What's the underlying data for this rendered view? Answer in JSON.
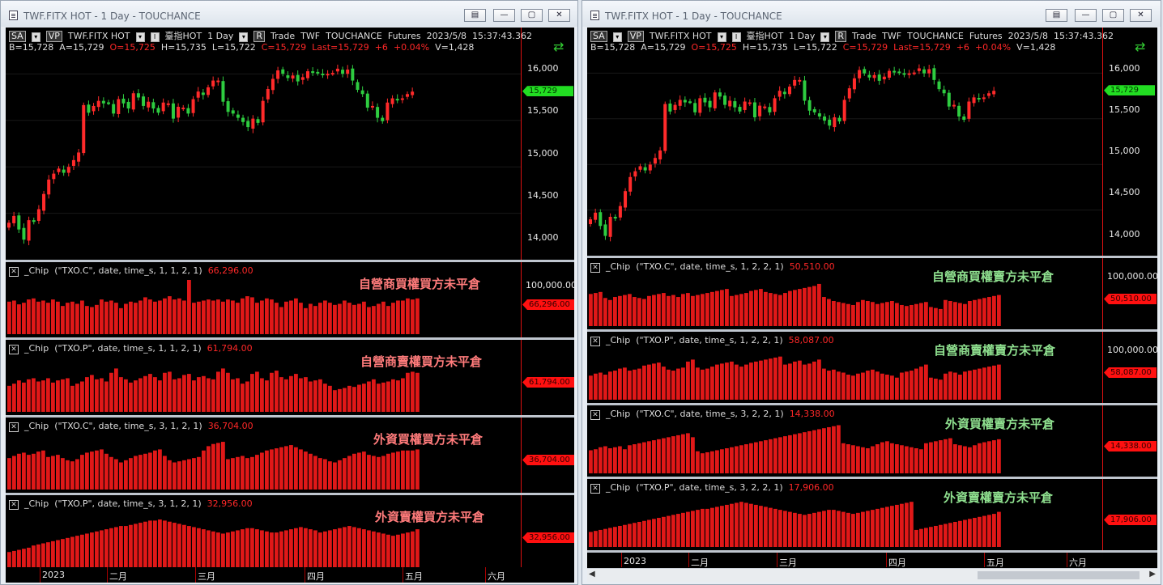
{
  "left": {
    "title": "TWF.FITX HOT - 1 Day - TOUCHANCE",
    "header": {
      "sa": "SA",
      "vp": "VP",
      "symbol": "TWF.FITX HOT",
      "name": "臺指HOT",
      "period": "1 Day",
      "r": "R",
      "trade": "Trade",
      "exch": "TWF",
      "src": "TOUCHANCE",
      "type": "Futures",
      "date": "2023/5/8",
      "time": "15:37:43.362"
    },
    "quote": {
      "b": "B=15,728",
      "a": "A=15,729",
      "o": "O=15,725",
      "h": "H=15,735",
      "l": "L=15,722",
      "c": "C=15,729",
      "last": "Last=15,729",
      "chg": "+6",
      "pct": "+0.04%",
      "v": "V=1,428"
    },
    "price_axis": [
      "16,000",
      "15,500",
      "15,000",
      "14,500",
      "14,000"
    ],
    "price_marker": "15,729",
    "panes": [
      {
        "label": "_Chip",
        "args": "(\"TXO.C\",  date,  time_s,  1,  1,  2,  1)",
        "value": "66,296.00",
        "axis": "100,000.00",
        "marker": "66,296.00",
        "title": "自營商買權買方未平倉"
      },
      {
        "label": "_Chip",
        "args": "(\"TXO.P\",  date,  time_s,  1,  1,  2,  1)",
        "value": "61,794.00",
        "axis": "",
        "marker": "61,794.00",
        "title": "自營商賣權買方未平倉"
      },
      {
        "label": "_Chip",
        "args": "(\"TXO.C\",  date,  time_s,  3,  1,  2,  1)",
        "value": "36,704.00",
        "axis": "",
        "marker": "36,704.00",
        "title": "外資買權買方未平倉"
      },
      {
        "label": "_Chip",
        "args": "(\"TXO.P\",  date,  time_s,  3,  1,  2,  1)",
        "value": "32,956.00",
        "axis": "",
        "marker": "32,956.00",
        "title": "外資賣權買方未平倉"
      }
    ],
    "x_axis": [
      "2023",
      "二月",
      "三月",
      "四月",
      "五月",
      "六月"
    ]
  },
  "right": {
    "title": "TWF.FITX HOT - 1 Day - TOUCHANCE",
    "header": {
      "sa": "SA",
      "vp": "VP",
      "symbol": "TWF.FITX HOT",
      "name": "臺指HOT",
      "period": "1 Day",
      "r": "R",
      "trade": "Trade",
      "exch": "TWF",
      "src": "TOUCHANCE",
      "type": "Futures",
      "date": "2023/5/8",
      "time": "15:37:43.362"
    },
    "quote": {
      "b": "B=15,728",
      "a": "A=15,729",
      "o": "O=15,725",
      "h": "H=15,735",
      "l": "L=15,722",
      "c": "C=15,729",
      "last": "Last=15,729",
      "chg": "+6",
      "pct": "+0.04%",
      "v": "V=1,428"
    },
    "price_axis": [
      "16,000",
      "15,500",
      "15,000",
      "14,500",
      "14,000"
    ],
    "price_marker": "15,729",
    "panes": [
      {
        "label": "_Chip",
        "args": "(\"TXO.C\",  date,  time_s,  1,  2,  2,  1)",
        "value": "50,510.00",
        "axis": "100,000.00",
        "marker": "50,510.00",
        "title": "自營商買權賣方未平倉"
      },
      {
        "label": "_Chip",
        "args": "(\"TXO.P\",  date,  time_s,  1,  2,  2,  1)",
        "value": "58,087.00",
        "axis": "100,000.00",
        "marker": "58,087.00",
        "title": "自營商賣權賣方未平倉"
      },
      {
        "label": "_Chip",
        "args": "(\"TXO.C\",  date,  time_s,  3,  2,  2,  1)",
        "value": "14,338.00",
        "axis": "",
        "marker": "14,338.00",
        "title": "外資買權賣方未平倉"
      },
      {
        "label": "_Chip",
        "args": "(\"TXO.P\",  date,  time_s,  3,  2,  2,  1)",
        "value": "17,906.00",
        "axis": "",
        "marker": "17,906.00",
        "title": "外資賣權賣方未平倉"
      }
    ],
    "x_axis": [
      "2023",
      "二月",
      "三月",
      "四月",
      "五月",
      "六月"
    ]
  },
  "colors": {
    "up": "#ff2a2a",
    "down": "#2ecc40",
    "bar": "#e01818",
    "title_left": "#ff7b7b",
    "title_right": "#8fe08f",
    "marker_price": "#22dd22",
    "marker_value": "#ff1010"
  },
  "chart_data": {
    "type": "bar",
    "title": "",
    "y_price_range": [
      13800,
      16200
    ],
    "candles_close": [
      14180,
      14260,
      14100,
      13980,
      14210,
      14190,
      14340,
      14520,
      14690,
      14760,
      14820,
      14770,
      14840,
      14920,
      15010,
      15570,
      15480,
      15560,
      15620,
      15590,
      15600,
      15470,
      15640,
      15590,
      15530,
      15710,
      15660,
      15560,
      15610,
      15530,
      15480,
      15600,
      15590,
      15410,
      15550,
      15540,
      15470,
      15640,
      15730,
      15690,
      15780,
      15860,
      15860,
      15610,
      15490,
      15470,
      15420,
      15370,
      15310,
      15410,
      15360,
      15620,
      15760,
      15880,
      15980,
      15940,
      15890,
      15920,
      15850,
      15900,
      15970,
      15950,
      15960,
      15940,
      15940,
      15950,
      16000,
      15940,
      15990,
      15860,
      15750,
      15700,
      15540,
      15560,
      15420,
      15380,
      15600,
      15650,
      15640,
      15650,
      15700,
      15729
    ],
    "series_left": [
      {
        "name": "自營商買權買方未平倉",
        "values": [
          60,
          62,
          55,
          58,
          64,
          66,
          60,
          62,
          58,
          64,
          60,
          52,
          58,
          60,
          56,
          62,
          52,
          50,
          54,
          64,
          60,
          62,
          58,
          48,
          56,
          60,
          58,
          62,
          68,
          64,
          60,
          62,
          66,
          70,
          64,
          66,
          62,
          100,
          58,
          60,
          62,
          64,
          62,
          64,
          60,
          64,
          62,
          58,
          66,
          70,
          68,
          58,
          62,
          66,
          64,
          58,
          50,
          60,
          62,
          66,
          58,
          48,
          56,
          52,
          58,
          62,
          58,
          54,
          56,
          62,
          58,
          54,
          56,
          60,
          50,
          52,
          56,
          60,
          52,
          58,
          62,
          62,
          66,
          64,
          66
        ]
      },
      {
        "name": "自營商賣權買方未平倉",
        "values": [
          48,
          52,
          58,
          54,
          60,
          62,
          56,
          58,
          62,
          54,
          58,
          60,
          62,
          48,
          52,
          56,
          64,
          68,
          60,
          62,
          56,
          72,
          80,
          64,
          60,
          54,
          58,
          62,
          66,
          70,
          64,
          58,
          72,
          74,
          60,
          62,
          68,
          70,
          58,
          64,
          66,
          62,
          60,
          74,
          80,
          72,
          60,
          62,
          52,
          56,
          70,
          74,
          62,
          58,
          72,
          76,
          64,
          60,
          66,
          70,
          62,
          64,
          56,
          58,
          60,
          52,
          48,
          40,
          42,
          44,
          48,
          46,
          50,
          52,
          56,
          60,
          52,
          54,
          56,
          60,
          58,
          62,
          72,
          74,
          72
        ]
      },
      {
        "name": "外資買權買方未平倉",
        "values": [
          58,
          62,
          66,
          68,
          64,
          66,
          70,
          72,
          60,
          62,
          64,
          58,
          54,
          52,
          56,
          64,
          68,
          70,
          72,
          74,
          66,
          60,
          56,
          50,
          54,
          58,
          62,
          64,
          66,
          68,
          72,
          74,
          62,
          54,
          50,
          52,
          54,
          56,
          58,
          60,
          72,
          80,
          84,
          86,
          88,
          56,
          58,
          60,
          62,
          58,
          60,
          64,
          68,
          72,
          74,
          76,
          78,
          80,
          82,
          78,
          74,
          70,
          66,
          62,
          58,
          56,
          52,
          50,
          54,
          58,
          62,
          66,
          68,
          70,
          64,
          62,
          60,
          62,
          66,
          68,
          70,
          72,
          72,
          72,
          74
        ]
      },
      {
        "name": "外資賣權買方未平倉",
        "values": [
          28,
          30,
          32,
          34,
          36,
          40,
          42,
          44,
          46,
          48,
          50,
          52,
          54,
          56,
          58,
          60,
          62,
          64,
          66,
          68,
          70,
          72,
          74,
          76,
          76,
          78,
          80,
          82,
          84,
          86,
          86,
          88,
          86,
          84,
          82,
          80,
          78,
          76,
          74,
          72,
          70,
          68,
          66,
          64,
          62,
          64,
          66,
          68,
          70,
          72,
          72,
          70,
          68,
          66,
          64,
          64,
          66,
          68,
          70,
          72,
          74,
          72,
          70,
          68,
          64,
          66,
          68,
          70,
          72,
          74,
          76,
          74,
          72,
          70,
          68,
          66,
          64,
          62,
          60,
          58,
          60,
          62,
          64,
          66,
          70
        ]
      }
    ],
    "series_right": [
      {
        "name": "自營商買權賣方未平倉",
        "values": [
          64,
          66,
          68,
          56,
          52,
          58,
          60,
          62,
          64,
          58,
          56,
          54,
          60,
          62,
          64,
          66,
          60,
          62,
          58,
          64,
          66,
          60,
          62,
          64,
          66,
          68,
          70,
          72,
          74,
          60,
          62,
          64,
          66,
          70,
          72,
          74,
          68,
          66,
          64,
          62,
          66,
          70,
          72,
          74,
          76,
          78,
          80,
          84,
          58,
          54,
          50,
          48,
          46,
          44,
          42,
          48,
          52,
          50,
          48,
          44,
          46,
          48,
          50,
          46,
          42,
          40,
          42,
          44,
          46,
          48,
          38,
          36,
          34,
          52,
          50,
          48,
          46,
          44,
          50,
          52,
          54,
          56,
          58,
          60,
          62
        ]
      },
      {
        "name": "自營商賣權賣方未平倉",
        "values": [
          48,
          52,
          54,
          50,
          56,
          58,
          62,
          64,
          58,
          60,
          62,
          68,
          70,
          72,
          74,
          66,
          60,
          58,
          62,
          64,
          76,
          80,
          64,
          60,
          62,
          66,
          70,
          72,
          74,
          76,
          70,
          66,
          70,
          74,
          76,
          78,
          80,
          82,
          84,
          86,
          70,
          72,
          76,
          78,
          70,
          72,
          76,
          80,
          62,
          58,
          60,
          56,
          54,
          50,
          48,
          52,
          54,
          58,
          60,
          56,
          52,
          50,
          48,
          44,
          54,
          56,
          58,
          62,
          66,
          70,
          44,
          42,
          40,
          52,
          56,
          54,
          50,
          56,
          58,
          60,
          62,
          64,
          66,
          68,
          70
        ]
      },
      {
        "name": "外資買權賣方未平倉",
        "values": [
          46,
          48,
          52,
          54,
          50,
          52,
          54,
          48,
          56,
          58,
          60,
          62,
          64,
          66,
          68,
          70,
          72,
          74,
          76,
          78,
          80,
          72,
          44,
          40,
          42,
          44,
          46,
          48,
          50,
          52,
          54,
          56,
          58,
          60,
          62,
          64,
          66,
          68,
          70,
          72,
          74,
          76,
          78,
          80,
          82,
          84,
          86,
          88,
          90,
          92,
          94,
          96,
          60,
          58,
          56,
          54,
          52,
          50,
          54,
          58,
          62,
          64,
          60,
          58,
          56,
          54,
          52,
          50,
          48,
          60,
          62,
          64,
          66,
          68,
          70,
          58,
          56,
          54,
          52,
          56,
          60,
          62,
          64,
          66,
          68
        ]
      },
      {
        "name": "外資賣權賣方未平倉",
        "values": [
          30,
          32,
          34,
          36,
          38,
          40,
          42,
          44,
          46,
          48,
          50,
          52,
          54,
          56,
          58,
          60,
          62,
          64,
          66,
          68,
          70,
          72,
          74,
          76,
          76,
          78,
          80,
          82,
          84,
          86,
          88,
          90,
          88,
          86,
          84,
          82,
          80,
          78,
          76,
          74,
          72,
          70,
          68,
          66,
          64,
          66,
          68,
          70,
          72,
          74,
          74,
          72,
          70,
          68,
          66,
          68,
          70,
          72,
          74,
          76,
          78,
          80,
          82,
          84,
          86,
          88,
          90,
          34,
          36,
          38,
          40,
          42,
          44,
          46,
          48,
          50,
          52,
          54,
          56,
          58,
          60,
          62,
          64,
          66,
          70
        ]
      }
    ]
  }
}
